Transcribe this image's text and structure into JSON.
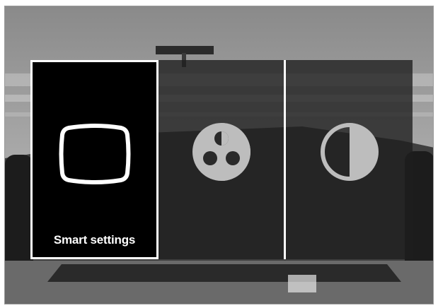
{
  "menu": {
    "items": [
      {
        "label": "Smart settings",
        "icon": "screen-icon",
        "selected": true
      },
      {
        "label": "",
        "icon": "color-icon",
        "selected": false
      },
      {
        "label": "",
        "icon": "contrast-icon",
        "selected": false
      }
    ]
  },
  "colors": {
    "selected_tile_bg": "#000000",
    "selected_border": "#ffffff",
    "icon_active": "#ffffff",
    "icon_inactive": "#bdbdbd"
  }
}
